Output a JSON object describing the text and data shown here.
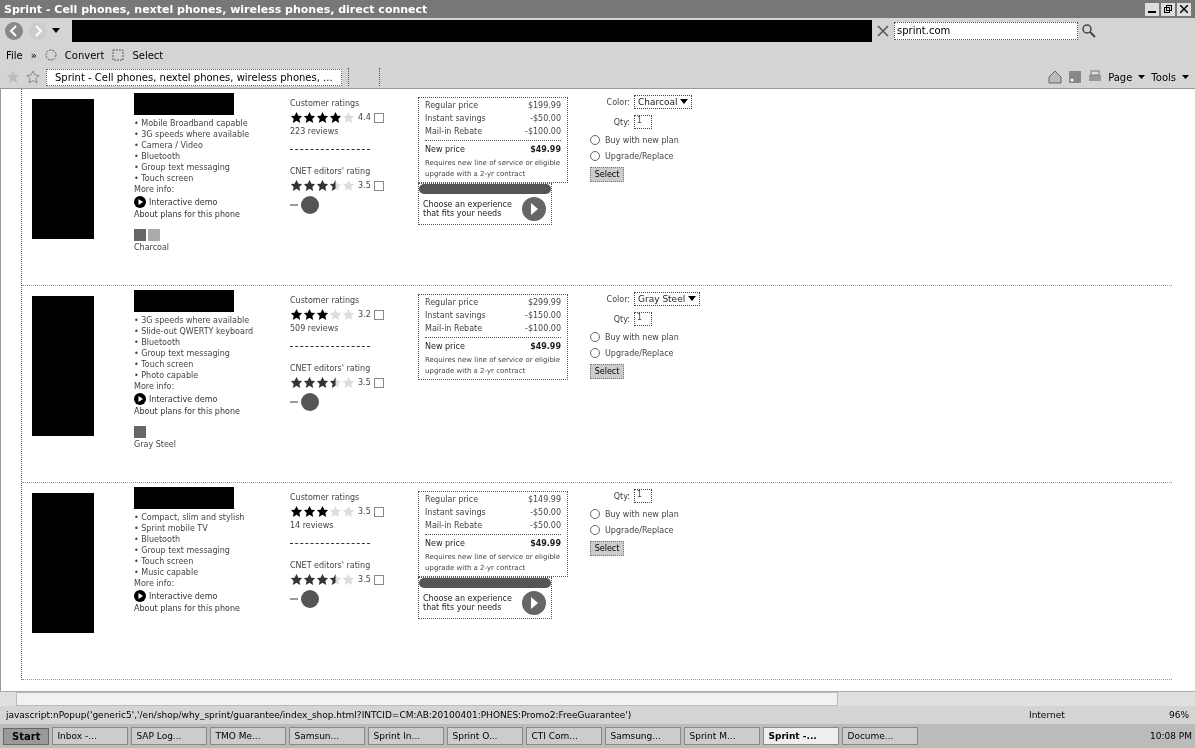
{
  "window": {
    "title": "Sprint - Cell phones, nextel phones, wireless phones, direct connect"
  },
  "address_bar": {
    "search_value": "sprint.com"
  },
  "menu": [
    "File",
    "»",
    "Convert",
    "Select"
  ],
  "tabs": [
    {
      "label": "Sprint - Cell phones, nextel phones, wireless phones, ...",
      "selected": true
    }
  ],
  "command_bar": [
    "Page",
    "Tools"
  ],
  "products": [
    {
      "features": [
        "• Mobile Broadband capable",
        "• 3G speeds where available",
        "• Camera / Video",
        "• Bluetooth",
        "• Group text messaging",
        "• Touch screen"
      ],
      "more_info": "More info:",
      "demo_link": "Interactive demo",
      "plans_link": "About plans for this phone",
      "swatch_label": "Charcoal",
      "customer_rating_label": "Customer ratings",
      "stars": 4,
      "rating_score": "4.4",
      "reviews": "223 reviews",
      "cnet": {
        "label": "CNET editors' rating",
        "stars": 3.5,
        "score": "3.5"
      },
      "prices": [
        {
          "label": "Regular price",
          "value": "$199.99"
        },
        {
          "label": "Instant savings",
          "value": "-$50.00"
        },
        {
          "label": "Mail-in Rebate",
          "value": "-$100.00"
        }
      ],
      "new_price_label": "New price",
      "new_price": "$49.99",
      "price_note": "Requires new line of service or eligible upgrade with a 2-yr contract",
      "promo": {
        "text": "Choose an experience that fits your needs"
      },
      "color": {
        "label": "Color:",
        "value": "Charcoal"
      },
      "qty_label": "Qty:",
      "qty": "1",
      "plan_options": [
        {
          "label": "Buy with new plan",
          "selected": false
        },
        {
          "label": "Upgrade/Replace",
          "selected": false
        }
      ],
      "select_button": "Select"
    },
    {
      "features": [
        "• 3G speeds where available",
        "• Slide-out QWERTY keyboard",
        "• Bluetooth",
        "• Group text messaging",
        "• Touch screen",
        "• Photo capable"
      ],
      "more_info": "More info:",
      "demo_link": "Interactive demo",
      "plans_link": "About plans for this phone",
      "swatch_label": "Gray Steel",
      "customer_rating_label": "Customer ratings",
      "stars": 3,
      "rating_score": "3.2",
      "reviews": "509 reviews",
      "cnet": {
        "label": "CNET editors' rating",
        "stars": 3.5,
        "score": "3.5"
      },
      "prices": [
        {
          "label": "Regular price",
          "value": "$299.99"
        },
        {
          "label": "Instant savings",
          "value": "-$150.00"
        },
        {
          "label": "Mail-in Rebate",
          "value": "-$100.00"
        }
      ],
      "new_price_label": "New price",
      "new_price": "$49.99",
      "price_note": "Requires new line of service or eligible upgrade with a 2-yr contract",
      "color": {
        "label": "Color:",
        "value": "Gray Steel"
      },
      "qty_label": "Qty:",
      "qty": "1",
      "plan_options": [
        {
          "label": "Buy with new plan",
          "selected": false
        },
        {
          "label": "Upgrade/Replace",
          "selected": false
        }
      ],
      "select_button": "Select"
    },
    {
      "features": [
        "• Compact, slim and stylish",
        "• Sprint mobile TV",
        "• Bluetooth",
        "• Group text messaging",
        "• Touch screen",
        "• Music capable"
      ],
      "more_info": "More info:",
      "demo_link": "Interactive demo",
      "plans_link": "About plans for this phone",
      "customer_rating_label": "Customer ratings",
      "stars": 3,
      "rating_score": "3.5",
      "reviews": "14 reviews",
      "cnet": {
        "label": "CNET editors' rating",
        "stars": 3.5,
        "score": "3.5"
      },
      "prices": [
        {
          "label": "Regular price",
          "value": "$149.99"
        },
        {
          "label": "Instant savings",
          "value": "-$50.00"
        },
        {
          "label": "Mail-in Rebate",
          "value": "-$50.00"
        }
      ],
      "new_price_label": "New price",
      "new_price": "$49.99",
      "price_note": "Requires new line of service or eligible upgrade with a 2-yr contract",
      "promo": {
        "text": "Choose an experience that fits your needs"
      },
      "qty_label": "Qty:",
      "qty": "1",
      "plan_options": [
        {
          "label": "Buy with new plan",
          "selected": false
        },
        {
          "label": "Upgrade/Replace",
          "selected": false
        }
      ],
      "select_button": "Select"
    }
  ],
  "status_bar": {
    "url": "javascript:nPopup('generic5','/en/shop/why_sprint/guarantee/index_shop.html?INTCID=CM:AB:20100401:PHONES:Promo2:FreeGuarantee')",
    "zone": "Internet",
    "zoom": "96%"
  },
  "taskbar": {
    "start": "Start",
    "items": [
      {
        "label": "Inbox -...",
        "selected": false
      },
      {
        "label": "SAP Log...",
        "selected": false
      },
      {
        "label": "TMO Me...",
        "selected": false
      },
      {
        "label": "Samsun...",
        "selected": false
      },
      {
        "label": "Sprint In...",
        "selected": false
      },
      {
        "label": "Sprint O...",
        "selected": false
      },
      {
        "label": "CTI Com...",
        "selected": false
      },
      {
        "label": "Samsung...",
        "selected": false
      },
      {
        "label": "Sprint M...",
        "selected": false
      },
      {
        "label": "Sprint -...",
        "selected": true
      },
      {
        "label": "Docume...",
        "selected": false
      }
    ],
    "clock": "10:08 PM"
  }
}
